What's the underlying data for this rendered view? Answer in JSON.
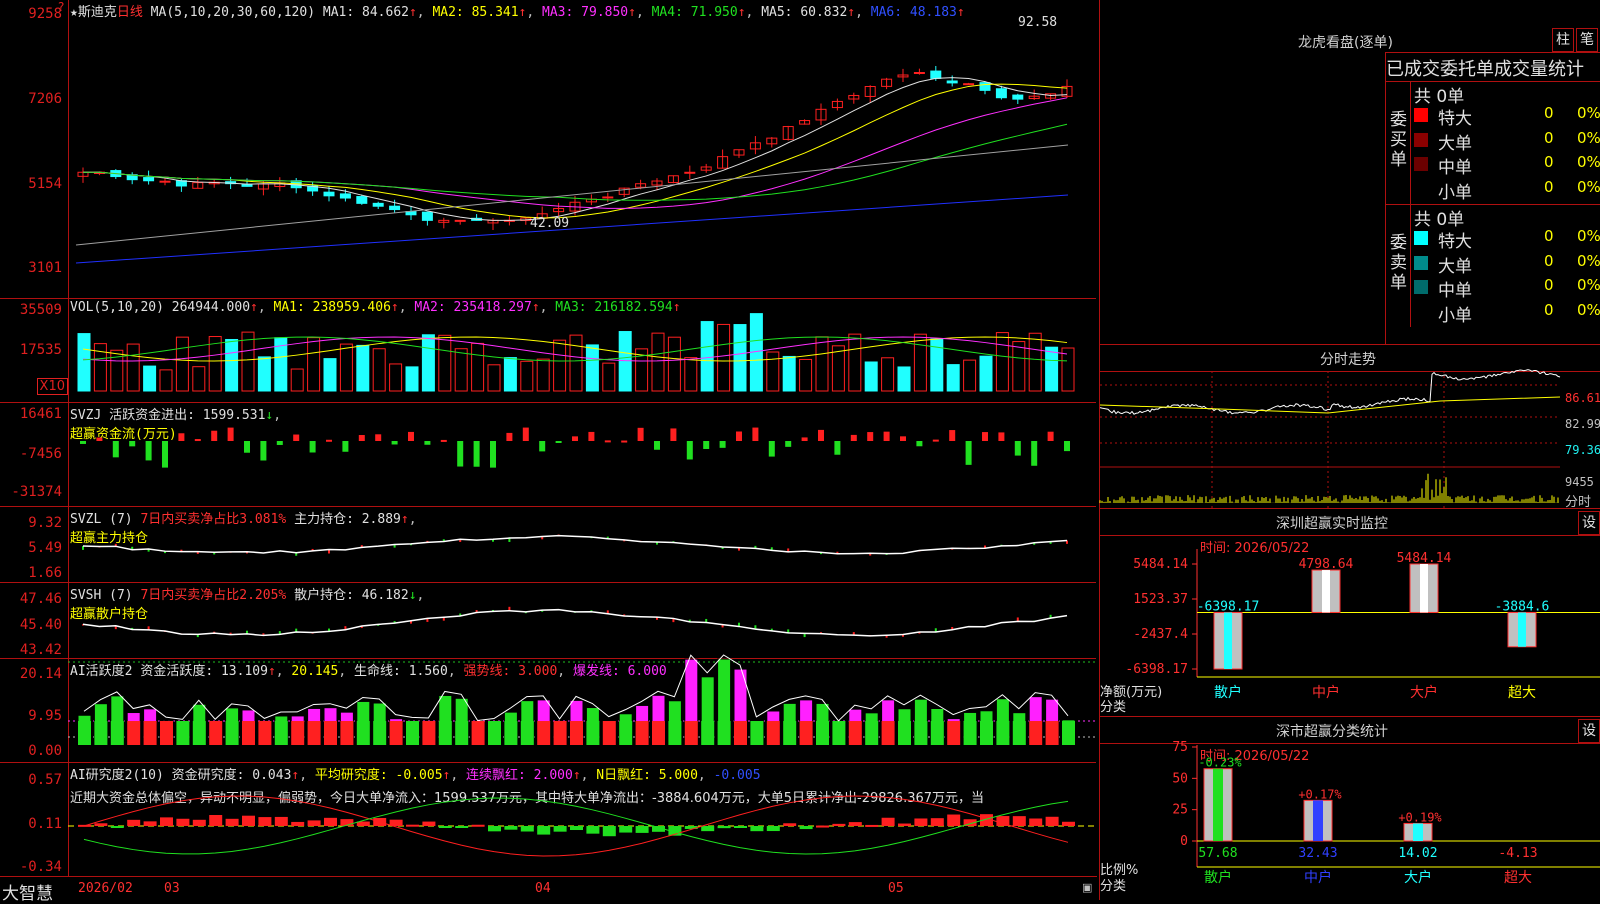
{
  "header": {
    "stock_name": "★斯迪克",
    "period": "日线",
    "ma_params": "MA(5,10,20,30,60,120)",
    "ma1": "MA1: 84.662",
    "ma2": "MA2: 85.341",
    "ma3": "MA3: 79.850",
    "ma4": "MA4: 71.950",
    "ma5": "MA5: 60.832",
    "ma6": "MA6: 48.183",
    "arrow": "↑",
    "high_label": "92.58",
    "low_label": "42.09"
  },
  "price_axis": [
    "9258",
    "7206",
    "5154",
    "3101"
  ],
  "vol": {
    "header": "VOL(5,10,20)",
    "value": "264944.000",
    "ma1": "MA1: 238959.406",
    "ma2": "MA2: 235418.297",
    "ma3": "MA3: 216182.594",
    "axis": [
      "35509",
      "17535"
    ],
    "unit": "X10"
  },
  "svzj": {
    "header": "SVZJ",
    "label": "活跃资金进出: 1599.531",
    "arrow_down": "↓",
    "sub": "超赢资金流(万元)",
    "axis": [
      "16461",
      "-7456",
      "-31374"
    ]
  },
  "svzl": {
    "header": "SVZL (7)",
    "ratio": "7日内买卖净占比3.081%",
    "hold": "主力持仓: 2.889",
    "sub": "超赢主力持仓",
    "axis": [
      "9.32",
      "5.49",
      "1.66"
    ]
  },
  "svsh": {
    "header": "SVSH (7)",
    "ratio": "7日内买卖净占比2.205%",
    "hold": "散户持仓: 46.182",
    "sub": "超赢散户持仓",
    "axis": [
      "47.46",
      "45.40",
      "43.42"
    ]
  },
  "ai1": {
    "header": "AI活跃度2",
    "active": "资金活跃度: 13.109",
    "v2": "20.145",
    "life": "生命线: 1.560",
    "strong": "强势线: 3.000",
    "burst": "爆发线: 6.000",
    "axis": [
      "20.14",
      "9.95",
      "0.00"
    ]
  },
  "ai2": {
    "header": "AI研究度2(10)",
    "research": "资金研究度: 0.043",
    "avg": "平均研究度: -0.005",
    "lian": "连续飘红: 2.000",
    "nday": "N日飘红: 5.000",
    "neg": "-0.005",
    "comment": "近期大资金总体偏空，异动不明显，偏弱势，今日大单净流入：1599.537万元，其中特大单净流出：-3884.604万元，大单5日累计净出-29826.367万元，当",
    "axis": [
      "0.57",
      "0.11",
      "-0.34"
    ]
  },
  "footer": {
    "brand": "大智慧",
    "dates": [
      "2026/02",
      "03",
      "04",
      "05"
    ]
  },
  "lhb": {
    "title": "龙虎看盘(逐单)",
    "btn1": "柱",
    "btn2": "笔",
    "subtitle": "已成交委托单成交量统计",
    "buy_label": "委买单",
    "sell_label": "委卖单",
    "buy_total": "共 0单",
    "sell_total": "共 0单",
    "rows": [
      {
        "name": "特大",
        "count": "0",
        "pct": "0%"
      },
      {
        "name": "大单",
        "count": "0",
        "pct": "0%"
      },
      {
        "name": "中单",
        "count": "0",
        "pct": "0%"
      },
      {
        "name": "小单",
        "count": "0",
        "pct": "0%"
      }
    ],
    "buy_colors": [
      "#ff0000",
      "#8b0000",
      "#6b0000",
      "#000000"
    ],
    "sell_colors": [
      "#00ffff",
      "#008b8b",
      "#006b6b",
      "#000000"
    ]
  },
  "intraday": {
    "title": "分时走势",
    "axis": [
      "86.61",
      "82.99",
      "79.36",
      "9455"
    ],
    "unit": "分时"
  },
  "sz_monitor": {
    "title": "深圳超赢实时监控",
    "btn": "设",
    "time": "时间: 2026/05/22",
    "axis": [
      "5484.14",
      "1523.37",
      "-2437.4",
      "-6398.17"
    ],
    "net_label": "净额(万元)",
    "cat_label": "分类",
    "bars": [
      {
        "name": "散户",
        "value": -6398.17,
        "label": "-6398.17"
      },
      {
        "name": "中户",
        "value": 4798.64,
        "label": "4798.64"
      },
      {
        "name": "大户",
        "value": 5484.14,
        "label": "5484.14"
      },
      {
        "name": "超大",
        "value": -3884.6,
        "label": "-3884.6"
      }
    ]
  },
  "sz_class": {
    "title": "深市超赢分类统计",
    "btn": "设",
    "time": "时间: 2026/05/22",
    "axis": [
      "75",
      "50",
      "25",
      "0"
    ],
    "ratio_label": "比例%",
    "cat_label": "分类",
    "bars": [
      {
        "name": "散户",
        "value": 57.68,
        "label": "57.68",
        "change": "-0.23%"
      },
      {
        "name": "中户",
        "value": 32.43,
        "label": "32.43",
        "change": "+0.17%"
      },
      {
        "name": "大户",
        "value": 14.02,
        "label": "14.02",
        "change": "+0.19%"
      },
      {
        "name": "超大",
        "value": -4.13,
        "label": "-4.13",
        "change": ""
      }
    ]
  }
}
